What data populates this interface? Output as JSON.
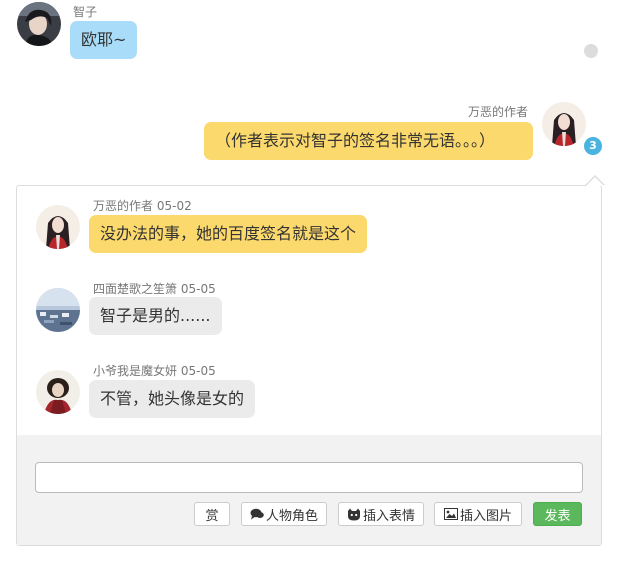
{
  "chat": {
    "msg1": {
      "name": "智子",
      "text": "欧耶~"
    },
    "msg2": {
      "name": "万恶的作者",
      "text": "（作者表示对智子的签名非常无语。。。）",
      "badge": "3"
    }
  },
  "replies": [
    {
      "name": "万恶的作者",
      "date": "05-02",
      "text": "没办法的事，她的百度签名就是这个"
    },
    {
      "name": "四面楚歌之笙箫",
      "date": "05-05",
      "text": "智子是男的......"
    },
    {
      "name": "小爷我是魔女妍",
      "date": "05-05",
      "text": "不管，她头像是女的"
    }
  ],
  "reply_form": {
    "input_value": "",
    "reward_label": "赏",
    "role_label": "人物角色",
    "emoji_label": "插入表情",
    "image_label": "插入图片",
    "send_label": "发表"
  },
  "icons": {
    "role": "chat-bubble-icon",
    "emoji": "cat-face-icon",
    "image": "picture-icon",
    "status": "gray-dot-icon"
  },
  "colors": {
    "blue_bubble": "#a8dcf8",
    "yellow_bubble": "#fcd96c",
    "gray_bubble": "#ebebeb",
    "badge": "#4ab3e0",
    "send_button": "#5cb85c"
  }
}
